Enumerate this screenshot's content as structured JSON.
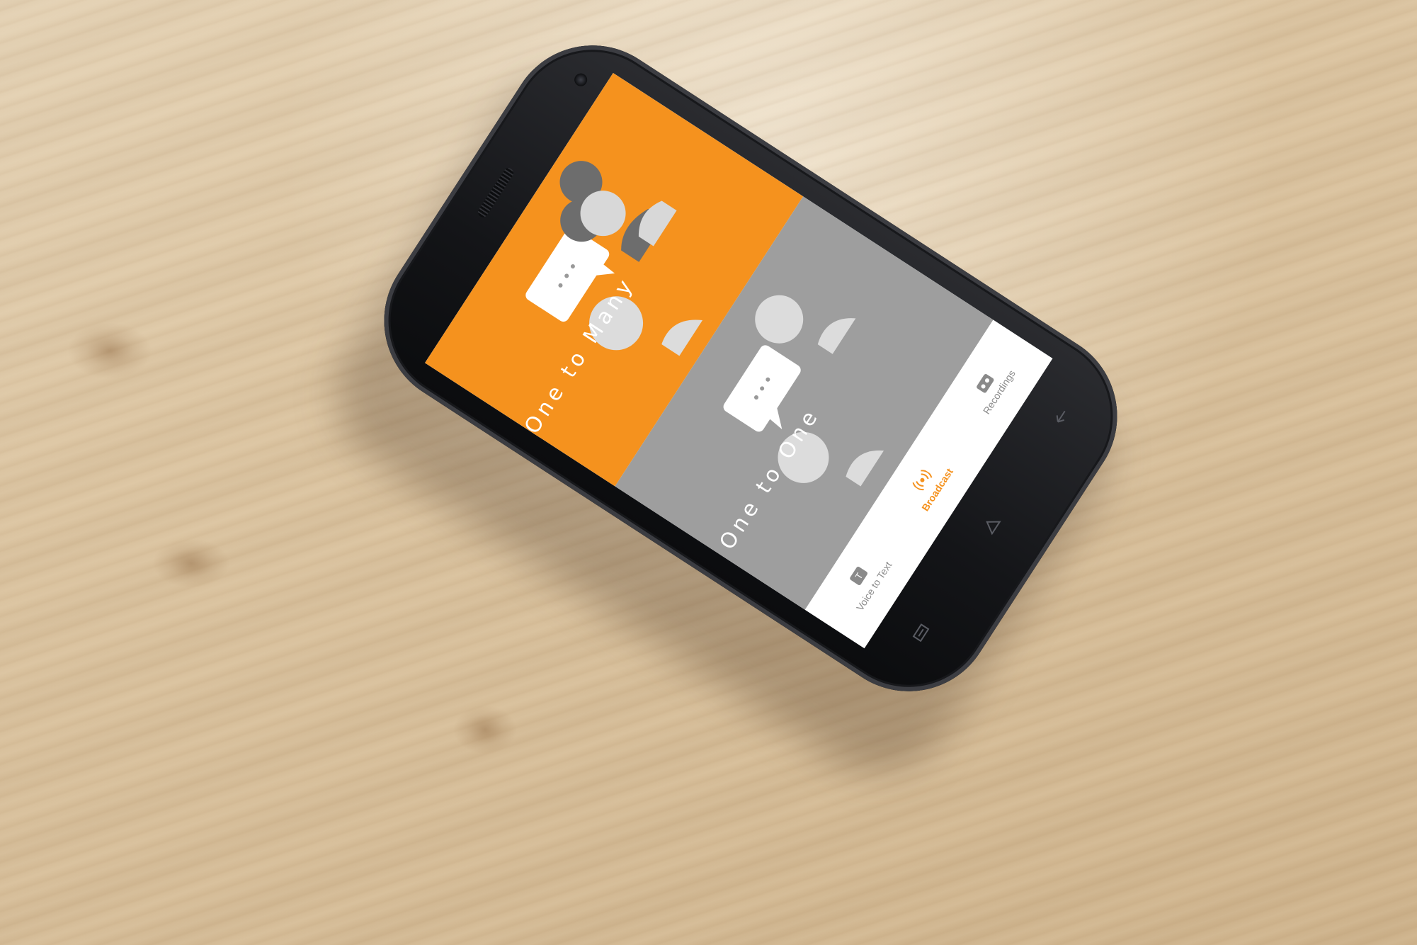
{
  "panels": [
    {
      "id": "one-to-many",
      "label": "One to Many",
      "color": "#f5921e",
      "active": true
    },
    {
      "id": "one-to-one",
      "label": "One to One",
      "color": "#9e9e9e",
      "active": false
    }
  ],
  "tabs": [
    {
      "id": "recordings",
      "label": "Recordings",
      "icon": "tape-icon",
      "active": false
    },
    {
      "id": "broadcast",
      "label": "Broadcast",
      "icon": "broadcast-icon",
      "active": true
    },
    {
      "id": "voice-to-text",
      "label": "Voice to Text",
      "icon": "text-icon",
      "active": false
    }
  ],
  "colors": {
    "accent": "#f5921e",
    "inactive_panel": "#9e9e9e",
    "tab_text": "#8a8a8a"
  },
  "system_keys": [
    "back-icon",
    "home-icon",
    "menu-icon"
  ]
}
